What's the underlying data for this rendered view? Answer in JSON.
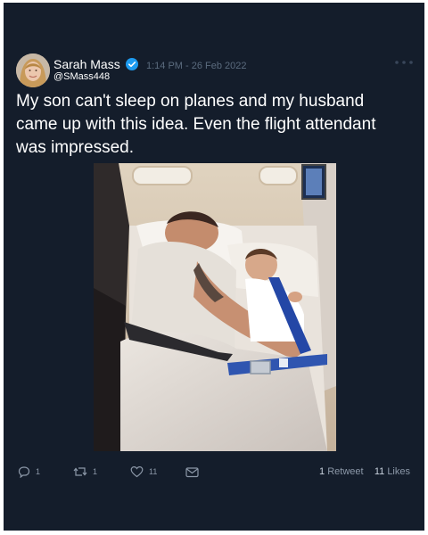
{
  "tweet": {
    "author_name": "Sarah Mass",
    "author_handle": "@SMass448",
    "timestamp": "1:14 PM - 26 Feb 2022",
    "text": "My son can't sleep on planes and my husband came up with this idea. Even the flight attendant was impressed.",
    "reply_count": "1",
    "retweet_count": "1",
    "like_count": "11",
    "retweets_label": "Retweet",
    "retweets_total": "1",
    "likes_label": "Likes",
    "likes_total": "11"
  },
  "icons": {
    "verified": "verified-badge-icon",
    "more": "more-dots-icon",
    "reply": "reply-icon",
    "retweet": "retweet-icon",
    "like": "heart-icon",
    "message": "message-icon"
  },
  "colors": {
    "background": "#141d2b",
    "verified": "#1d9bf0",
    "muted": "#5b6b7e"
  }
}
